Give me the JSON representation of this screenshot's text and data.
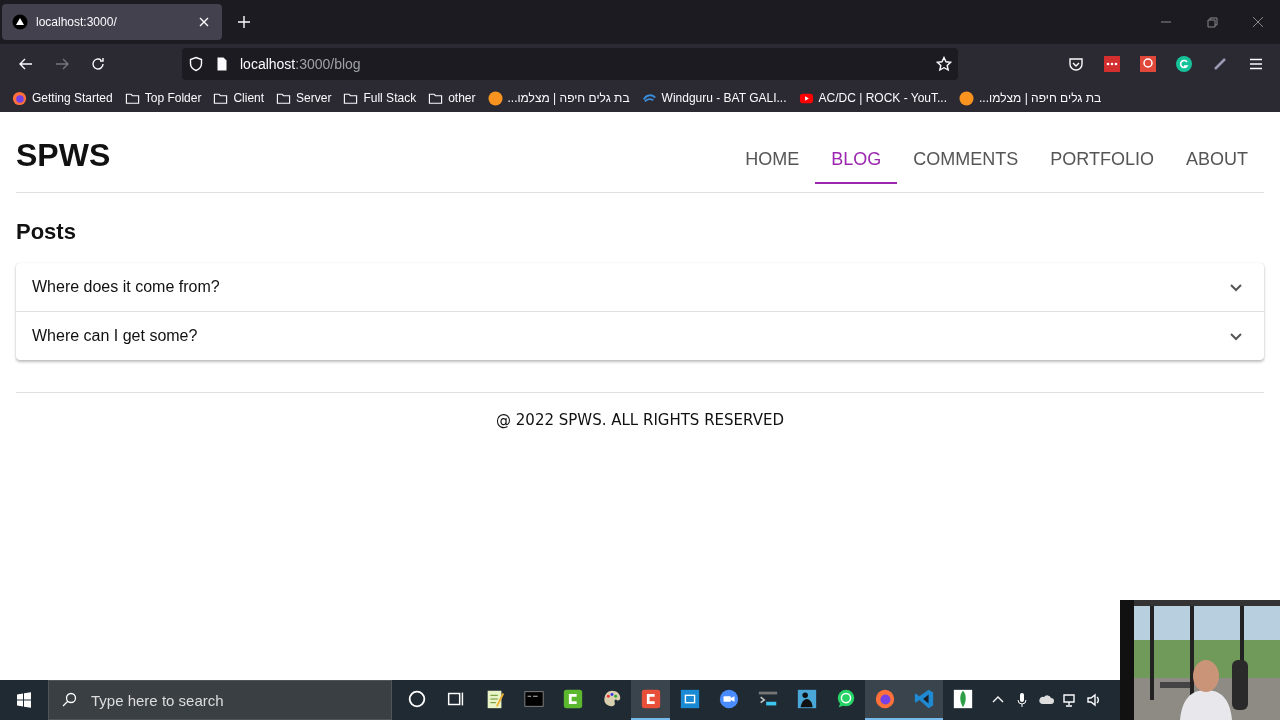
{
  "browser": {
    "tab": {
      "title": "localhost:3000/"
    },
    "url": {
      "host": "localhost",
      "path": ":3000/blog"
    },
    "bookmarks": [
      {
        "kind": "firefox",
        "label": "Getting Started"
      },
      {
        "kind": "folder",
        "label": "Top Folder"
      },
      {
        "kind": "folder",
        "label": "Client"
      },
      {
        "kind": "folder",
        "label": "Server"
      },
      {
        "kind": "folder",
        "label": "Full Stack"
      },
      {
        "kind": "folder",
        "label": "other"
      },
      {
        "kind": "orange",
        "label": "בת גלים חיפה | מצלמו..."
      },
      {
        "kind": "windguru",
        "label": "Windguru - BAT GALI..."
      },
      {
        "kind": "youtube",
        "label": "AC/DC | ROCK - YouT..."
      },
      {
        "kind": "orange",
        "label": "בת גלים חיפה | מצלמו..."
      }
    ]
  },
  "site": {
    "logo": "SPWS",
    "nav": [
      {
        "label": "HOME",
        "selected": false
      },
      {
        "label": "BLOG",
        "selected": true
      },
      {
        "label": "COMMENTS",
        "selected": false
      },
      {
        "label": "PORTFOLIO",
        "selected": false
      },
      {
        "label": "ABOUT",
        "selected": false
      }
    ],
    "heading": "Posts",
    "posts": [
      {
        "title": "Where does it come from?",
        "expanded": false
      },
      {
        "title": "Where can I get some?",
        "expanded": false
      }
    ],
    "footer": "@ 2022 SPWS. ALL RIGHTS RESERVED"
  },
  "taskbar": {
    "search": {
      "placeholder": "Type here to search"
    },
    "apps": [
      {
        "kind": "cortana",
        "active": false
      },
      {
        "kind": "taskview",
        "active": false
      },
      {
        "kind": "notepad",
        "active": false
      },
      {
        "kind": "cmd",
        "active": false
      },
      {
        "kind": "camtasia-green",
        "active": false
      },
      {
        "kind": "paint",
        "active": false
      },
      {
        "kind": "camtasia-red",
        "active": true
      },
      {
        "kind": "remote",
        "active": false
      },
      {
        "kind": "zoom",
        "active": false
      },
      {
        "kind": "terminal",
        "active": false
      },
      {
        "kind": "kindle",
        "active": false
      },
      {
        "kind": "whatsapp",
        "active": false
      },
      {
        "kind": "firefox",
        "active": true
      },
      {
        "kind": "vscode",
        "active": true
      },
      {
        "kind": "mongodb",
        "active": false
      }
    ]
  }
}
